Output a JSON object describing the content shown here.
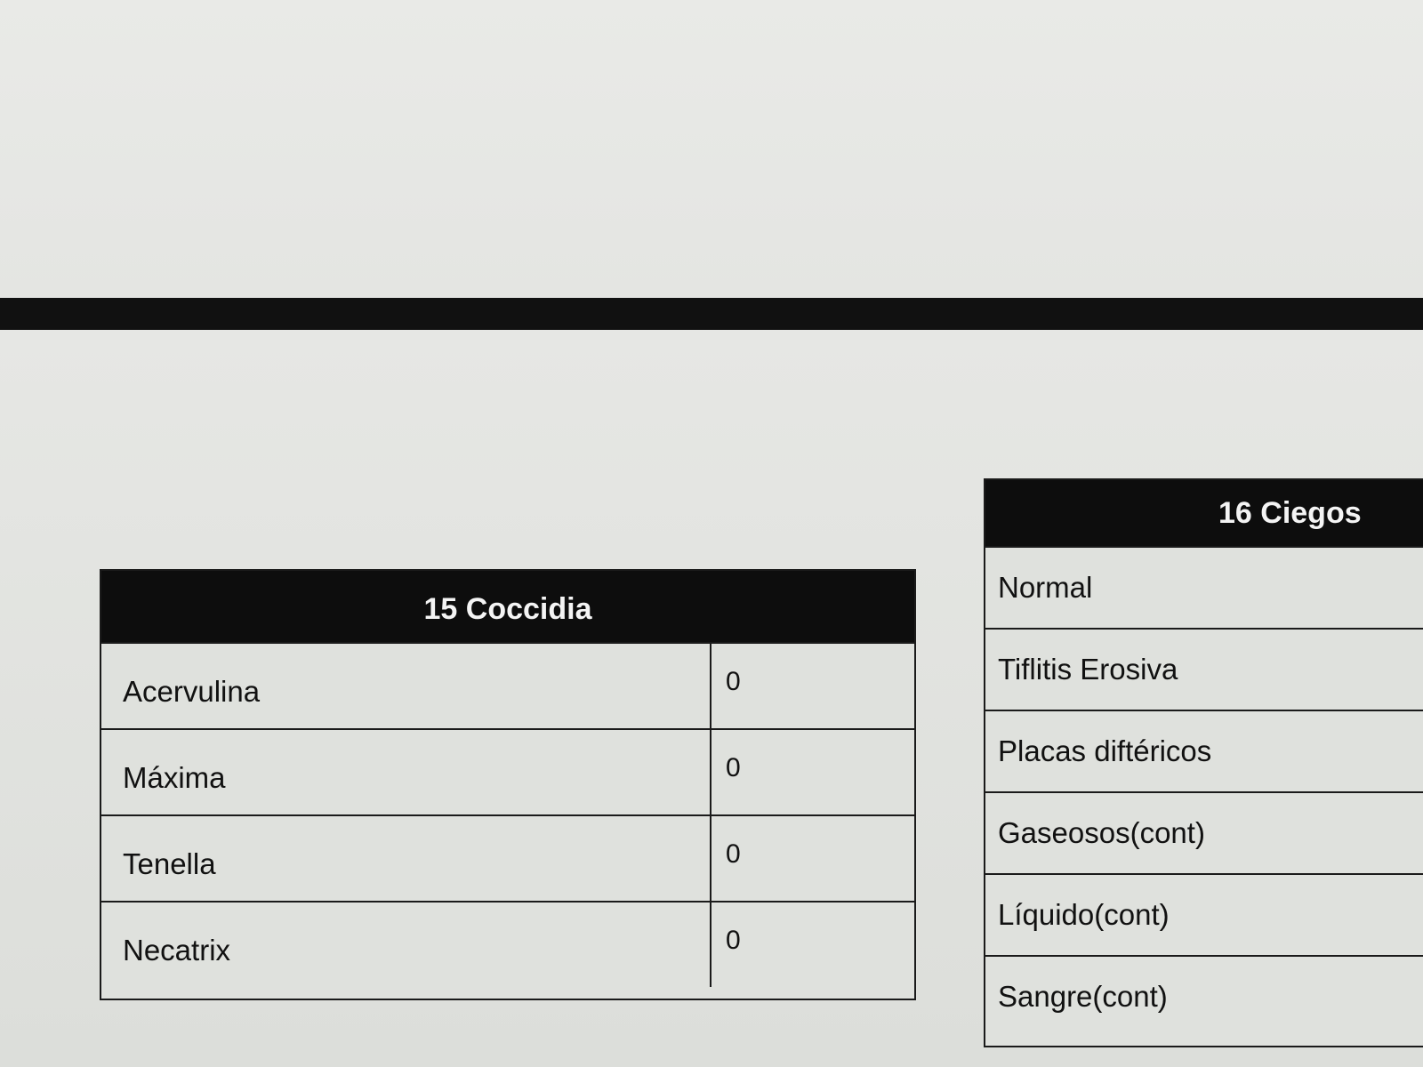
{
  "panels": {
    "coccidia": {
      "title": "15 Coccidia",
      "rows": [
        {
          "label": "Acervulina",
          "value": "0"
        },
        {
          "label": "Máxima",
          "value": "0"
        },
        {
          "label": "Tenella",
          "value": "0"
        },
        {
          "label": "Necatrix",
          "value": "0"
        }
      ]
    },
    "ciegos": {
      "title": "16 Ciegos",
      "rows": [
        {
          "label": "Normal"
        },
        {
          "label": "Tiflitis Erosiva"
        },
        {
          "label": "Placas diftéricos"
        },
        {
          "label": "Gaseosos(cont)"
        },
        {
          "label": "Líquido(cont)"
        },
        {
          "label": "Sangre(cont)"
        }
      ]
    }
  },
  "colors": {
    "header_bg": "#0d0d0d",
    "header_text": "#f4f4f4",
    "panel_bg": "#dfe1dd",
    "page_bg": "#e8e9e6",
    "divider": "#111111"
  }
}
